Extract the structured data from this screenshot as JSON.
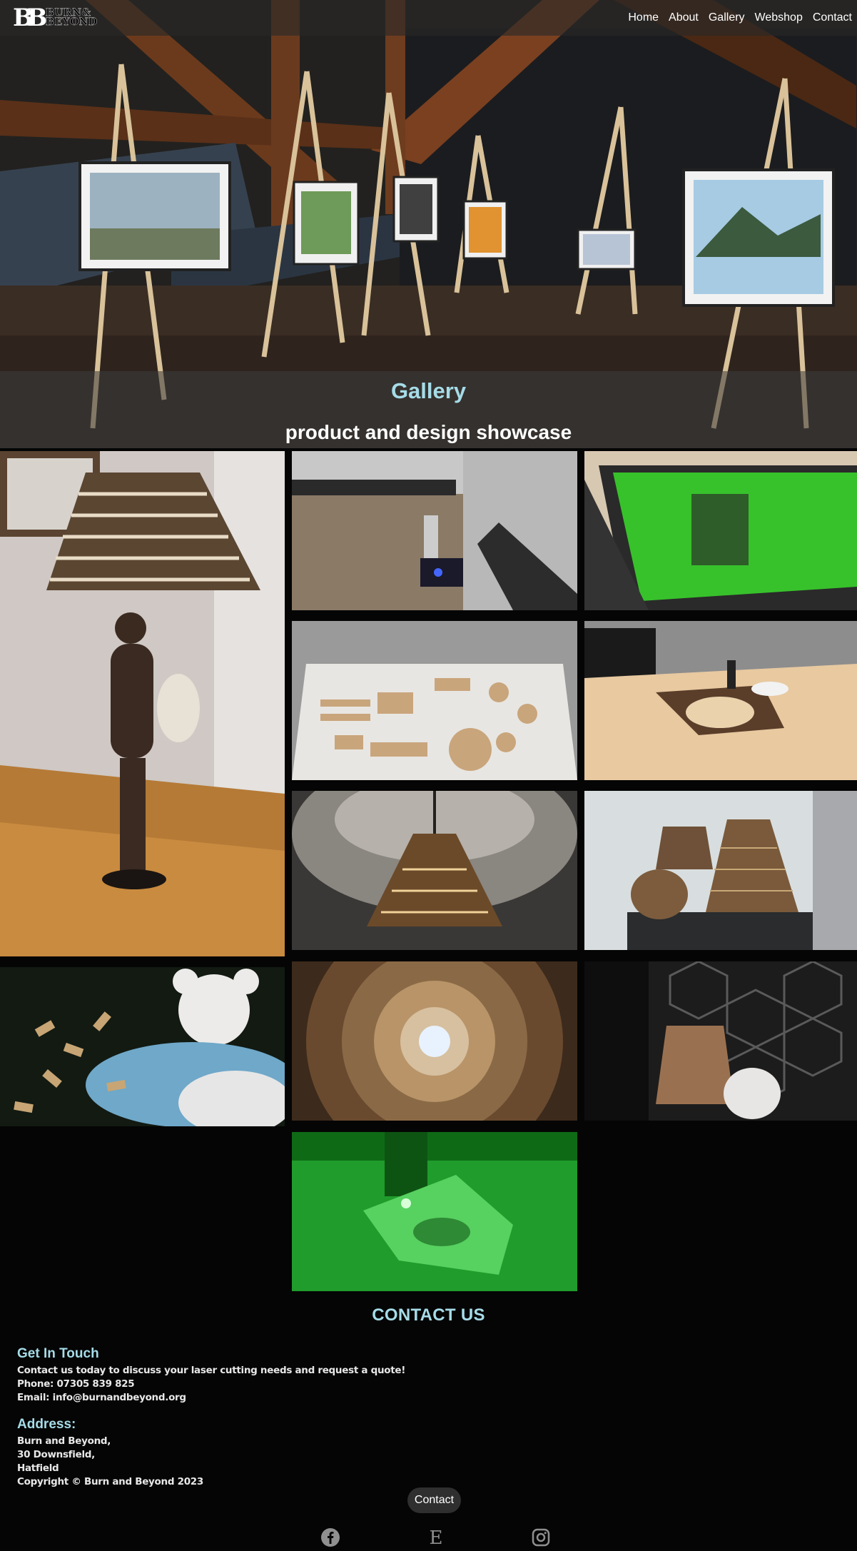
{
  "brand": {
    "mark": "BB",
    "line1": "BURN&",
    "line2": "BEYOND"
  },
  "nav": {
    "items": [
      "Home",
      "About",
      "Gallery",
      "Webshop",
      "Contact"
    ]
  },
  "hero": {
    "title": "Gallery",
    "subtitle": "product and design showcase"
  },
  "gallery": {
    "images": [
      "figurine-lamp-photo",
      "laser-cutter-bed-photo",
      "green-laser-machine-photo",
      "wooden-cutouts-photo",
      "airbrush-table-photo",
      "pendant-lamp-photo",
      "cardboard-shades-photo",
      "crochet-bear-photo",
      "lamp-interior-photo",
      "lamp-hexagon-wall-photo",
      "green-laser-engraving-photo"
    ]
  },
  "contact": {
    "heading": "CONTACT US",
    "get_in_touch": {
      "title": "Get In Touch",
      "lines": [
        "Contact us today to discuss your laser cutting needs and request a quote!",
        "Phone: 07305 839 825",
        "Email: info@burnandbeyond.org"
      ]
    },
    "address": {
      "title": "Address:",
      "lines": [
        "Burn and Beyond,",
        "30 Downsfield,",
        "Hatfield",
        "Copyright © Burn and Beyond 2023"
      ]
    },
    "button_label": "Contact"
  },
  "social": [
    "facebook-icon",
    "etsy-icon",
    "instagram-icon"
  ],
  "colors": {
    "accent": "#a6dce8",
    "background": "#050505",
    "nav_bg": "#282828"
  }
}
